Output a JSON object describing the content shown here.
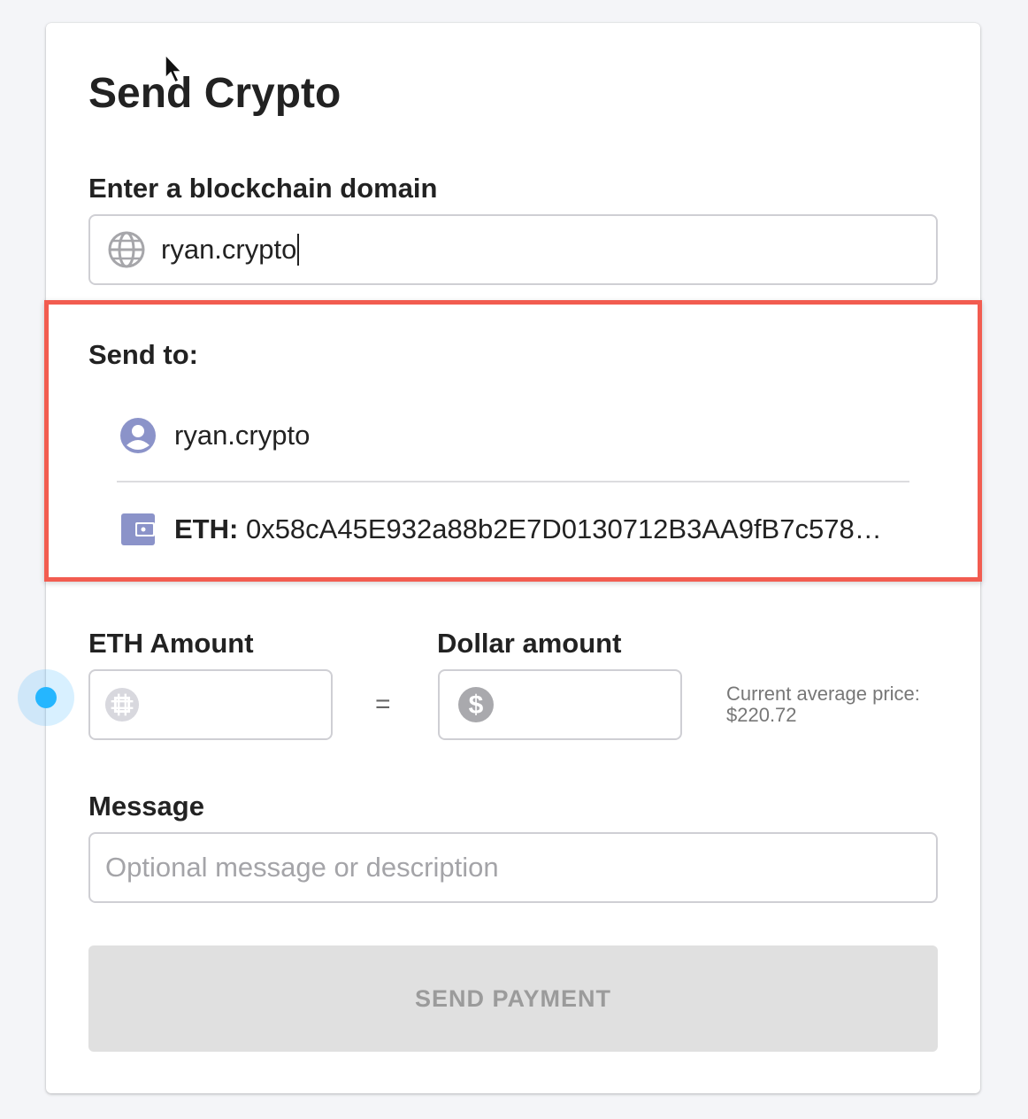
{
  "form": {
    "title": "Send Crypto",
    "domain_label": "Enter a blockchain domain",
    "domain_value": "ryan.crypto",
    "send_to_label": "Send to:",
    "recipient_name": "ryan.crypto",
    "eth_prefix": "ETH:",
    "eth_address": "0x58cA45E932a88b2E7D0130712B3AA9fB7c578…",
    "eth_amount_label": "ETH Amount",
    "dollar_amount_label": "Dollar amount",
    "equals": "=",
    "price_label": "Current average price:",
    "price_value": "$220.72",
    "message_label": "Message",
    "message_placeholder": "Optional message or description",
    "send_button": "SEND PAYMENT"
  },
  "icons": {
    "domain": "globe-icon",
    "recipient": "user-circle-icon",
    "address": "wallet-icon",
    "eth_amount": "crypto-coin-icon",
    "dollar_amount": "dollar-coin-icon"
  },
  "colors": {
    "highlight_border": "#f25c50",
    "icon_purple": "#8b93c9",
    "disabled_button_bg": "#e0e0e0",
    "disabled_button_text": "#9b9b9b",
    "cursor_dot": "#25b6ff"
  }
}
